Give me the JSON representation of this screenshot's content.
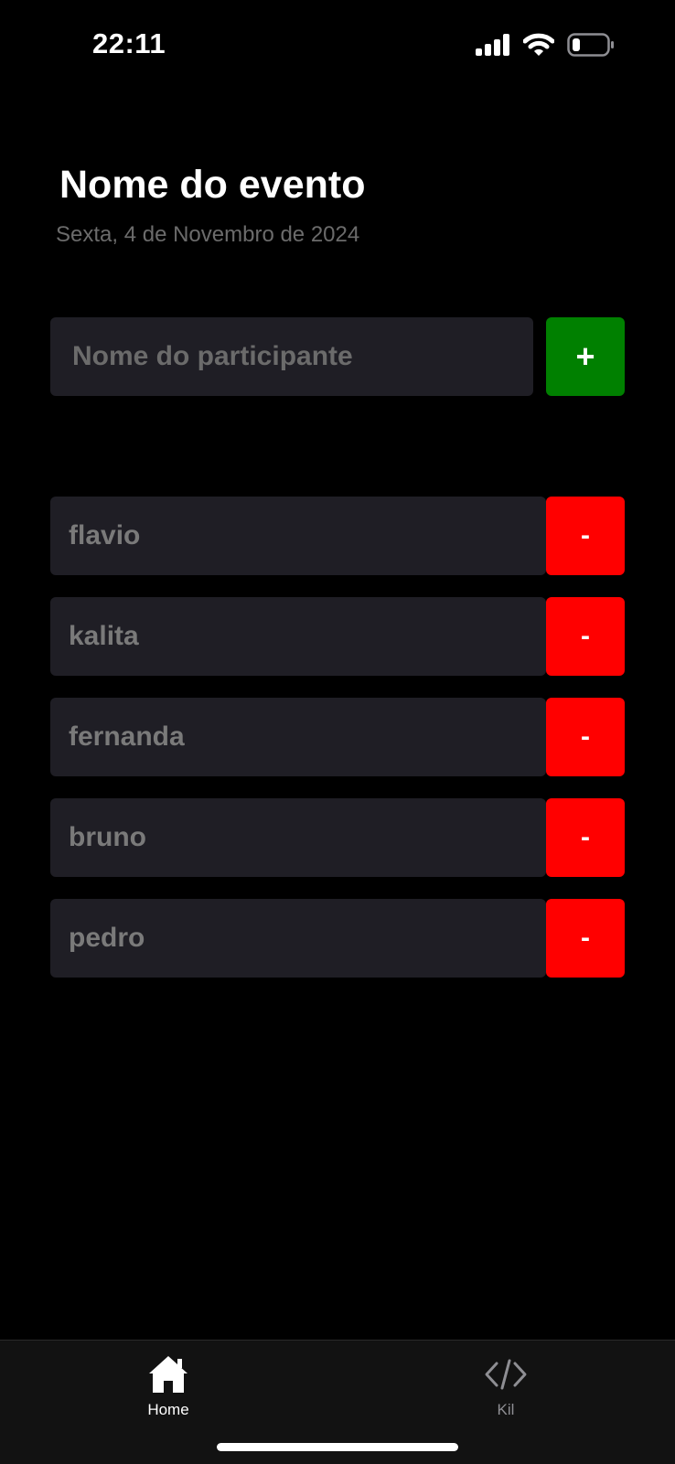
{
  "status_bar": {
    "time": "22:11",
    "icons": [
      "cellular-signal-icon",
      "wifi-icon",
      "battery-icon"
    ]
  },
  "header": {
    "title": "Nome do evento",
    "date": "Sexta, 4 de Novembro de 2024"
  },
  "form": {
    "input_placeholder": "Nome do participante",
    "input_value": "",
    "add_label": "+"
  },
  "participants": [
    {
      "name": "flavio",
      "remove_label": "-"
    },
    {
      "name": "kalita",
      "remove_label": "-"
    },
    {
      "name": "fernanda",
      "remove_label": "-"
    },
    {
      "name": "bruno",
      "remove_label": "-"
    },
    {
      "name": "pedro",
      "remove_label": "-"
    }
  ],
  "tabs": [
    {
      "label": "Home",
      "icon": "home-icon",
      "active": true
    },
    {
      "label": "Kil",
      "icon": "code-icon",
      "active": false
    }
  ],
  "colors": {
    "background": "#000000",
    "input_background": "#1f1e25",
    "add_button": "#008000",
    "remove_button": "#ff0000",
    "muted_text": "#6b6b6b"
  }
}
